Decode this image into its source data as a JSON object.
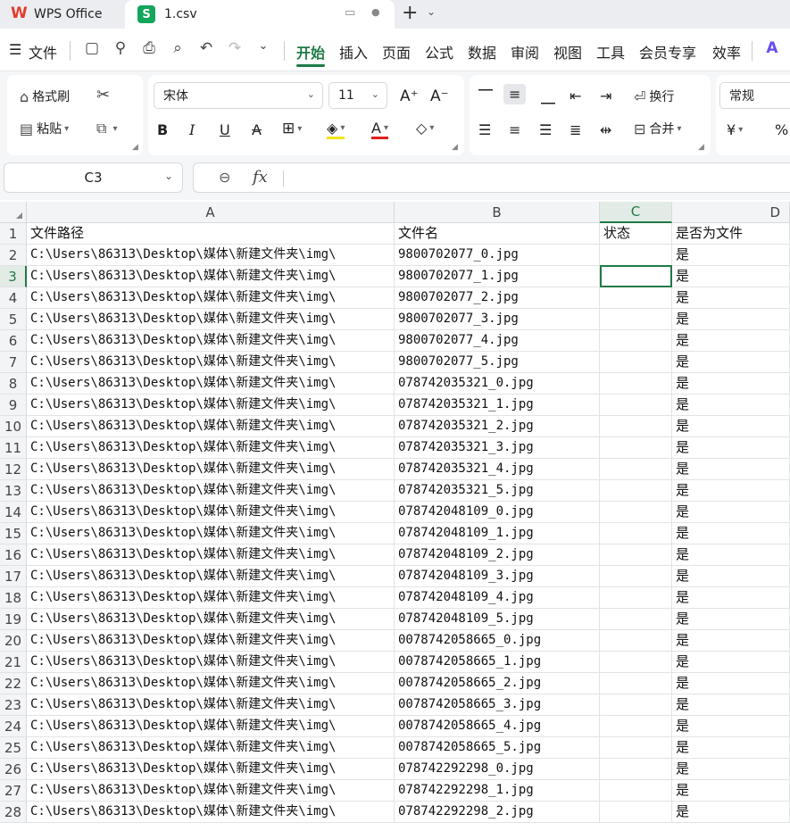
{
  "titlebar": {
    "app_tab": "WPS Office",
    "file_tab": "1.csv",
    "file_badge": "S",
    "new_tab": "+"
  },
  "menubar": {
    "file_menu": "文件",
    "tabs": [
      "开始",
      "插入",
      "页面",
      "公式",
      "数据",
      "审阅",
      "视图",
      "工具",
      "会员专享",
      "效率"
    ],
    "active_tab": "开始"
  },
  "ribbon": {
    "format_painter": "格式刷",
    "paste": "粘贴",
    "font_name": "宋体",
    "font_size": "11",
    "wrap": "换行",
    "merge": "合并",
    "number_format": "常规",
    "currency": "¥",
    "percent": "%"
  },
  "formula_bar": {
    "cell_ref": "C3",
    "fx": "fx",
    "content": ""
  },
  "sheet": {
    "columns": [
      "A",
      "B",
      "C",
      "D"
    ],
    "selected_column": "C",
    "selected_row": 3,
    "rows": [
      {
        "n": "1",
        "a": "文件路径",
        "b": "文件名",
        "c": "状态",
        "d": "是否为文件"
      },
      {
        "n": "2",
        "a": "C:\\Users\\86313\\Desktop\\媒体\\新建文件夹\\img\\",
        "b": "9800702077_0.jpg",
        "c": "",
        "d": "是"
      },
      {
        "n": "3",
        "a": "C:\\Users\\86313\\Desktop\\媒体\\新建文件夹\\img\\",
        "b": "9800702077_1.jpg",
        "c": "",
        "d": "是"
      },
      {
        "n": "4",
        "a": "C:\\Users\\86313\\Desktop\\媒体\\新建文件夹\\img\\",
        "b": "9800702077_2.jpg",
        "c": "",
        "d": "是"
      },
      {
        "n": "5",
        "a": "C:\\Users\\86313\\Desktop\\媒体\\新建文件夹\\img\\",
        "b": "9800702077_3.jpg",
        "c": "",
        "d": "是"
      },
      {
        "n": "6",
        "a": "C:\\Users\\86313\\Desktop\\媒体\\新建文件夹\\img\\",
        "b": "9800702077_4.jpg",
        "c": "",
        "d": "是"
      },
      {
        "n": "7",
        "a": "C:\\Users\\86313\\Desktop\\媒体\\新建文件夹\\img\\",
        "b": "9800702077_5.jpg",
        "c": "",
        "d": "是"
      },
      {
        "n": "8",
        "a": "C:\\Users\\86313\\Desktop\\媒体\\新建文件夹\\img\\",
        "b": "078742035321_0.jpg",
        "c": "",
        "d": "是"
      },
      {
        "n": "9",
        "a": "C:\\Users\\86313\\Desktop\\媒体\\新建文件夹\\img\\",
        "b": "078742035321_1.jpg",
        "c": "",
        "d": "是"
      },
      {
        "n": "10",
        "a": "C:\\Users\\86313\\Desktop\\媒体\\新建文件夹\\img\\",
        "b": "078742035321_2.jpg",
        "c": "",
        "d": "是"
      },
      {
        "n": "11",
        "a": "C:\\Users\\86313\\Desktop\\媒体\\新建文件夹\\img\\",
        "b": "078742035321_3.jpg",
        "c": "",
        "d": "是"
      },
      {
        "n": "12",
        "a": "C:\\Users\\86313\\Desktop\\媒体\\新建文件夹\\img\\",
        "b": "078742035321_4.jpg",
        "c": "",
        "d": "是"
      },
      {
        "n": "13",
        "a": "C:\\Users\\86313\\Desktop\\媒体\\新建文件夹\\img\\",
        "b": "078742035321_5.jpg",
        "c": "",
        "d": "是"
      },
      {
        "n": "14",
        "a": "C:\\Users\\86313\\Desktop\\媒体\\新建文件夹\\img\\",
        "b": "078742048109_0.jpg",
        "c": "",
        "d": "是"
      },
      {
        "n": "15",
        "a": "C:\\Users\\86313\\Desktop\\媒体\\新建文件夹\\img\\",
        "b": "078742048109_1.jpg",
        "c": "",
        "d": "是"
      },
      {
        "n": "16",
        "a": "C:\\Users\\86313\\Desktop\\媒体\\新建文件夹\\img\\",
        "b": "078742048109_2.jpg",
        "c": "",
        "d": "是"
      },
      {
        "n": "17",
        "a": "C:\\Users\\86313\\Desktop\\媒体\\新建文件夹\\img\\",
        "b": "078742048109_3.jpg",
        "c": "",
        "d": "是"
      },
      {
        "n": "18",
        "a": "C:\\Users\\86313\\Desktop\\媒体\\新建文件夹\\img\\",
        "b": "078742048109_4.jpg",
        "c": "",
        "d": "是"
      },
      {
        "n": "19",
        "a": "C:\\Users\\86313\\Desktop\\媒体\\新建文件夹\\img\\",
        "b": "078742048109_5.jpg",
        "c": "",
        "d": "是"
      },
      {
        "n": "20",
        "a": "C:\\Users\\86313\\Desktop\\媒体\\新建文件夹\\img\\",
        "b": "0078742058665_0.jpg",
        "c": "",
        "d": "是"
      },
      {
        "n": "21",
        "a": "C:\\Users\\86313\\Desktop\\媒体\\新建文件夹\\img\\",
        "b": "0078742058665_1.jpg",
        "c": "",
        "d": "是"
      },
      {
        "n": "22",
        "a": "C:\\Users\\86313\\Desktop\\媒体\\新建文件夹\\img\\",
        "b": "0078742058665_2.jpg",
        "c": "",
        "d": "是"
      },
      {
        "n": "23",
        "a": "C:\\Users\\86313\\Desktop\\媒体\\新建文件夹\\img\\",
        "b": "0078742058665_3.jpg",
        "c": "",
        "d": "是"
      },
      {
        "n": "24",
        "a": "C:\\Users\\86313\\Desktop\\媒体\\新建文件夹\\img\\",
        "b": "0078742058665_4.jpg",
        "c": "",
        "d": "是"
      },
      {
        "n": "25",
        "a": "C:\\Users\\86313\\Desktop\\媒体\\新建文件夹\\img\\",
        "b": "0078742058665_5.jpg",
        "c": "",
        "d": "是"
      },
      {
        "n": "26",
        "a": "C:\\Users\\86313\\Desktop\\媒体\\新建文件夹\\img\\",
        "b": "078742292298_0.jpg",
        "c": "",
        "d": "是"
      },
      {
        "n": "27",
        "a": "C:\\Users\\86313\\Desktop\\媒体\\新建文件夹\\img\\",
        "b": "078742292298_1.jpg",
        "c": "",
        "d": "是"
      },
      {
        "n": "28",
        "a": "C:\\Users\\86313\\Desktop\\媒体\\新建文件夹\\img\\",
        "b": "078742292298_2.jpg",
        "c": "",
        "d": "是"
      }
    ]
  },
  "colors": {
    "accent": "#1f7a46",
    "badge": "#13a55b",
    "wps_red": "#e23b2c"
  }
}
